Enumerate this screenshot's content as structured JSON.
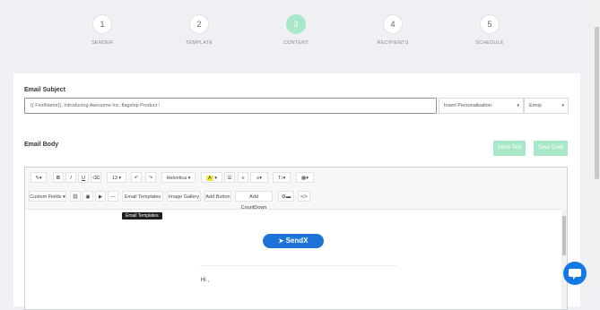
{
  "steps": [
    {
      "num": "1",
      "label": "SENDER"
    },
    {
      "num": "2",
      "label": "TEMPLATE"
    },
    {
      "num": "3",
      "label": "CONTENT"
    },
    {
      "num": "4",
      "label": "RECIPIENTS"
    },
    {
      "num": "5",
      "label": "SCHEDULE"
    }
  ],
  "subject": {
    "heading": "Email Subject",
    "value": "{{ FirstName}}, Introducing Awesome Inc. flagship Product !",
    "personalisation": "Insert Personalisation",
    "emoji": "Emoji"
  },
  "body": {
    "heading": "Email Body",
    "send_test": "Send Test",
    "save_draft": "Save Draft"
  },
  "toolbar": {
    "font_size": "13",
    "font_family": "Helvetica",
    "custom_fields": "Custom Fields",
    "email_templates": "Email Templates",
    "image_gallery": "Image Gallery",
    "add_button": "Add Button",
    "add_countdown": "Add CountDown",
    "code": "</>",
    "tooltip": "Email Templates"
  },
  "content": {
    "logo": "SendX",
    "greeting": "Hi ,"
  },
  "colors": {
    "accent": "#a9e7c9",
    "brand": "#1f73d8",
    "chat": "#1479e3"
  }
}
